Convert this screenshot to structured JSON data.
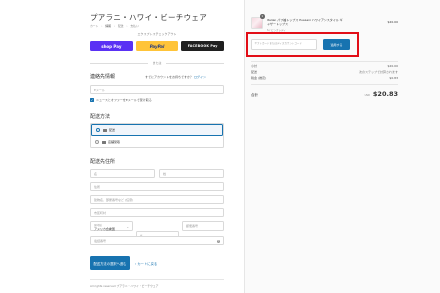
{
  "header": {
    "shop_title": "プアラニ・ハワイ・ビーチウェア",
    "breadcrumbs": [
      "カート",
      "情報",
      "配送",
      "支払い"
    ],
    "breadcrumb_separator": "›"
  },
  "express": {
    "label": "エクスプレスチェックアウト",
    "shoppay_label": "shop Pay",
    "paypal_label": "PayPal",
    "gpay_label": "FACEBOOK Pay",
    "divider_text": "または"
  },
  "contact": {
    "title": "連絡先情報",
    "login_prompt": "すでにアカウントをお持ちですか？",
    "login_link": "ログイン",
    "email_placeholder": "Eメール",
    "newsletter_label": "ニュースとオファーをEメールで受け取る"
  },
  "delivery": {
    "title": "配送方法",
    "options": [
      {
        "label": "配送",
        "selected": true
      },
      {
        "label": "店舗受取",
        "selected": false
      }
    ]
  },
  "address": {
    "title": "配送先住所",
    "first_name": "名",
    "last_name": "姓",
    "address1": "住所",
    "address2": "建物名、部屋番号など (任意)",
    "city": "市区町村",
    "country_label": "国/地域",
    "country_value": "アメリカ合衆国",
    "state_label": "州",
    "state_value": "ハワイ",
    "zip": "郵便番号",
    "phone": "電話番号"
  },
  "actions": {
    "continue_label": "配送方法の選択へ進む",
    "back_label": "カートに戻る"
  },
  "footer": {
    "rights": "All rights reserved プアラニ・ハワイ・ビーチウェア"
  },
  "summary": {
    "quantity": "1",
    "product_name": "Italian パフ袖トップス PuaLani ハワイアンスタイル ギャザートップス",
    "product_variant": "S / ピンクレディ",
    "product_price": "$20.00",
    "discount_placeholder": "ギフトカードまたはディスカウントコード",
    "apply_label": "適用する",
    "subtotal_label": "小計",
    "subtotal_value": "$20.00",
    "shipping_label": "配送",
    "shipping_value": "次のステップで計算されます",
    "tax_label": "税金 (推定)",
    "tax_value": "$0.83",
    "total_label": "合計",
    "currency": "USD",
    "total_value": "$20.83"
  },
  "colors": {
    "accent": "#1773b0",
    "highlight": "#e20e17"
  }
}
